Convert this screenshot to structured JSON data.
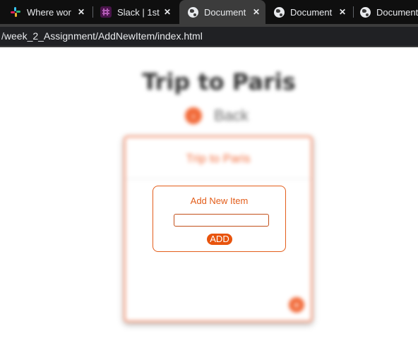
{
  "browser": {
    "tabs": [
      {
        "title": "Where wor",
        "icon": "slack-icon",
        "active": false
      },
      {
        "title": "Slack | 1st-",
        "icon": "slack-workspace-icon",
        "active": false
      },
      {
        "title": "Document",
        "icon": "globe-icon",
        "active": true
      },
      {
        "title": "Document",
        "icon": "globe-icon",
        "active": false
      },
      {
        "title": "Document",
        "icon": "globe-icon",
        "active": false
      }
    ],
    "close_glyph": "✕",
    "address": "/week_2_Assignment/AddNewItem/index.html"
  },
  "page": {
    "heading": "Trip to Paris",
    "back_label": "Back",
    "back_glyph": "‹",
    "card": {
      "title": "Trip to Paris",
      "fab_glyph": "+"
    },
    "modal": {
      "title": "Add New Item",
      "input_value": "",
      "input_placeholder": "",
      "add_label": "ADD"
    }
  },
  "colors": {
    "accent": "#e8540d",
    "accent_light": "#f26b3a",
    "tab_bar": "#0f0f0f",
    "active_tab": "#3c3c3c",
    "address_field": "#202124"
  }
}
